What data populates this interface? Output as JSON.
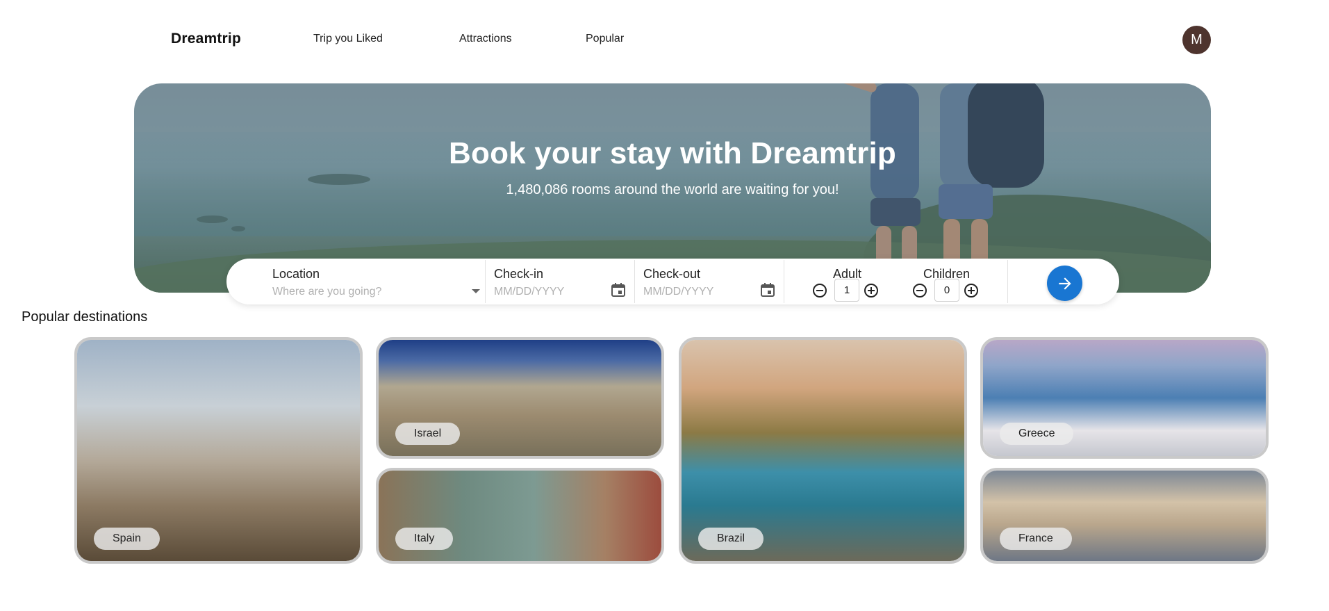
{
  "nav": {
    "brand": "Dreamtrip",
    "links": [
      "Trip you Liked",
      "Attractions",
      "Popular"
    ],
    "avatar_initial": "M",
    "avatar_color": "#4e342e"
  },
  "hero": {
    "title": "Book your stay with Dreamtrip",
    "subtitle": "1,480,086 rooms around the world are waiting for you!"
  },
  "search": {
    "location": {
      "label": "Location",
      "placeholder": "Where are you going?"
    },
    "checkin": {
      "label": "Check-in",
      "placeholder": "MM/DD/YYYY",
      "icon": "calendar-icon"
    },
    "checkout": {
      "label": "Check-out",
      "placeholder": "MM/DD/YYYY",
      "icon": "calendar-icon"
    },
    "adult": {
      "label": "Adult",
      "value": "1"
    },
    "children": {
      "label": "Children",
      "value": "0"
    },
    "submit_icon": "arrow-right-icon",
    "submit_color": "#1976d2"
  },
  "popular": {
    "title": "Popular destinations",
    "destinations": [
      "Spain",
      "Israel",
      "Italy",
      "Brazil",
      "Greece",
      "France"
    ]
  }
}
